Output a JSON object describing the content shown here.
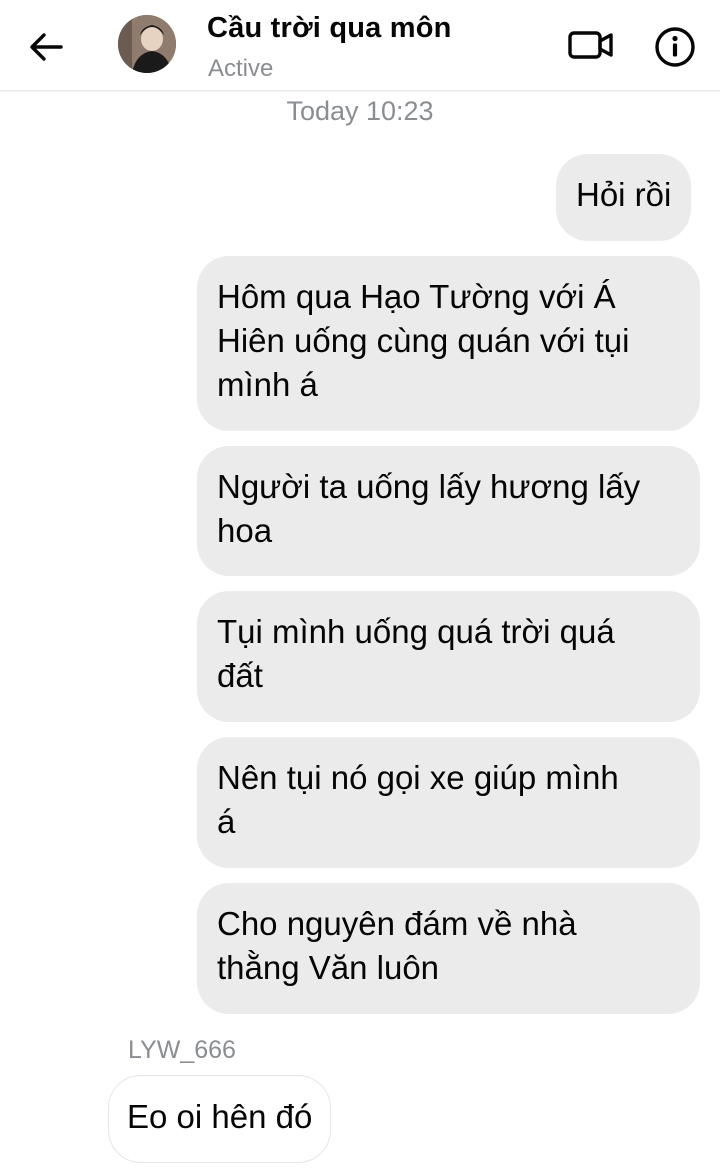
{
  "header": {
    "back_icon": "arrow-left-icon",
    "contact_name": "Cầu trời qua môn",
    "status": "Active",
    "video_icon": "video-camera-icon",
    "info_icon": "info-icon"
  },
  "conversation": {
    "timestamp": "Today 10:23",
    "outgoing": [
      {
        "lines": [
          "Hỏi rồi"
        ]
      },
      {
        "lines": [
          "Hôm qua Hạo Tường với Á",
          "Hiên uống cùng quán với tụi",
          "mình á"
        ]
      },
      {
        "lines": [
          "Người ta uống lấy hương lấy",
          "hoa"
        ]
      },
      {
        "lines": [
          "Tụi mình uống quá trời quá",
          "đất"
        ]
      },
      {
        "lines": [
          "Nên tụi nó gọi xe giúp mình",
          "á"
        ]
      },
      {
        "lines": [
          "Cho nguyên đám về nhà",
          "thằng Văn luôn"
        ]
      }
    ],
    "incoming": {
      "sender": "LYW_666",
      "text": "Eo oi hên đó"
    }
  },
  "colors": {
    "outgoing_bubble": "#ebebeb",
    "secondary_text": "#8a8d91",
    "primary_text": "#050505"
  }
}
